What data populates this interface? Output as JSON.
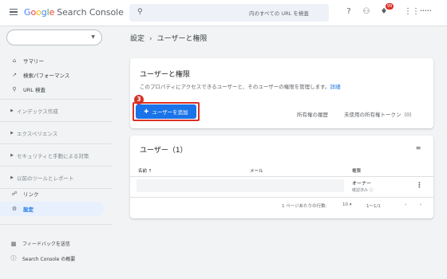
{
  "header": {
    "logo": [
      "G",
      "o",
      "o",
      "g",
      "l",
      "e"
    ],
    "product": "Search Console",
    "search_placeholder": "内のすべての URL を検査",
    "notification_count": "99",
    "account_label": "•••••"
  },
  "sidebar": {
    "property_label": "",
    "items": [
      {
        "label": "サマリー",
        "icon": "home-icon"
      },
      {
        "label": "検索パフォーマンス",
        "icon": "trend-icon"
      },
      {
        "label": "URL 検査",
        "icon": "search-icon"
      },
      {
        "label": "インデックス作成",
        "icon": "chevron-right-icon"
      },
      {
        "label": "エクスペリエンス",
        "icon": "chevron-right-icon"
      },
      {
        "label": "セキュリティと手動による対策",
        "icon": "chevron-right-icon"
      },
      {
        "label": "以前のツールとレポート",
        "icon": "chevron-right-icon"
      },
      {
        "label": "リンク",
        "icon": "link-icon"
      },
      {
        "label": "設定",
        "icon": "gear-icon"
      }
    ],
    "bottom": [
      {
        "label": "フィードバックを送信",
        "icon": "feedback-icon"
      },
      {
        "label": "Search Console の概要",
        "icon": "info-icon"
      }
    ]
  },
  "breadcrumb": {
    "parent": "設定",
    "separator": "›",
    "current": "ユーザーと権限"
  },
  "card_permissions": {
    "title": "ユーザーと権限",
    "description": "このプロパティにアクセスできるユーザーと、そのユーザーの権限を管理します。",
    "details_link": "詳細",
    "step_number": "3",
    "add_user_label": "ユーザーを追加",
    "ownership_history": "所有権の履歴",
    "unused_tokens": "未使用の所有権トークン（0）"
  },
  "card_users": {
    "title": "ユーザー（1）",
    "columns": [
      "名前 ↑",
      "メール",
      "権限"
    ],
    "rows": [
      {
        "name": "",
        "email": "",
        "permission": "オーナー",
        "status": "確認済み ⓘ"
      }
    ],
    "pager": {
      "rows_label": "1 ページあたりの行数:",
      "rows_value": "10",
      "range": "1〜1/1"
    }
  },
  "colors": {
    "accent": "#1a73e8",
    "highlight": "#d93025",
    "background": "#f1f3f4"
  }
}
